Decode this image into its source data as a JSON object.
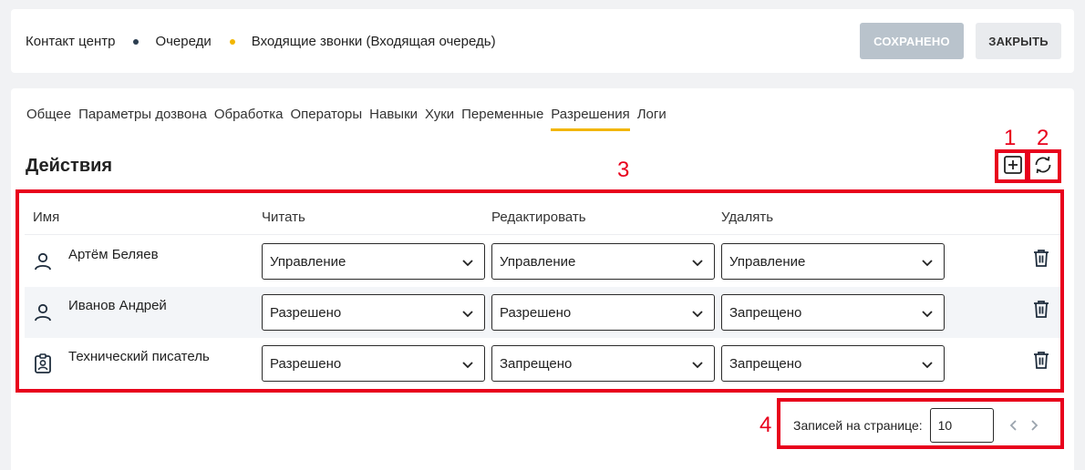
{
  "breadcrumb": {
    "items": [
      "Контакт центр",
      "Очереди",
      "Входящие звонки (Входящая очередь)"
    ],
    "dot_colors": [
      "#2c3e50",
      "#f2b600"
    ]
  },
  "header_buttons": {
    "saved_label": "Сохранено",
    "close_label": "Закрыть"
  },
  "tabs": [
    {
      "label": "Общее"
    },
    {
      "label": "Параметры дозвона"
    },
    {
      "label": "Обработка"
    },
    {
      "label": "Операторы"
    },
    {
      "label": "Навыки"
    },
    {
      "label": "Хуки"
    },
    {
      "label": "Переменные"
    },
    {
      "label": "Разрешения",
      "active": true
    },
    {
      "label": "Логи"
    }
  ],
  "section": {
    "title": "Действия",
    "add_icon": "plus-square-icon",
    "refresh_icon": "refresh-icon"
  },
  "table": {
    "columns": [
      "Имя",
      "Читать",
      "Редактировать",
      "Удалять"
    ],
    "rows": [
      {
        "icon": "user-icon",
        "name": "Артём Беляев",
        "read": "Управление",
        "edit": "Управление",
        "delete": "Управление"
      },
      {
        "icon": "user-icon",
        "name": "Иванов Андрей",
        "read": "Разрешено",
        "edit": "Разрешено",
        "delete": "Запрещено"
      },
      {
        "icon": "role-badge-icon",
        "name": "Технический писатель",
        "read": "Разрешено",
        "edit": "Запрещено",
        "delete": "Запрещено"
      }
    ]
  },
  "pagination": {
    "label": "Записей на странице:",
    "per_page": "10"
  },
  "annotations": {
    "labels": [
      "1",
      "2",
      "3",
      "4"
    ],
    "color": "#e8001c"
  },
  "colors": {
    "accent": "#f2b600",
    "saved_button": "#b9c3cc",
    "alt_row": "#f3f5f8"
  }
}
